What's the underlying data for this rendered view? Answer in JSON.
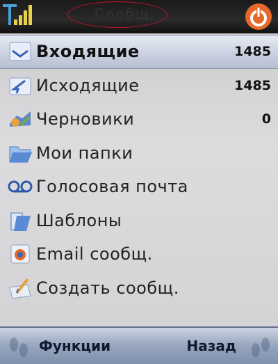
{
  "status_bar": {
    "title": "Сообщ.",
    "signal_icon": "signal-strength-icon",
    "power_icon": "power-icon"
  },
  "menu": {
    "items": [
      {
        "label": "Входящие",
        "count": "1485",
        "icon": "inbox-icon",
        "selected": true
      },
      {
        "label": "Исходящие",
        "count": "1485",
        "icon": "outbox-icon",
        "selected": false
      },
      {
        "label": "Черновики",
        "count": "0",
        "icon": "drafts-icon",
        "selected": false
      },
      {
        "label": "Мои папки",
        "count": "",
        "icon": "folder-icon",
        "selected": false
      },
      {
        "label": "Голосовая почта",
        "count": "",
        "icon": "voicemail-icon",
        "selected": false
      },
      {
        "label": "Шаблоны",
        "count": "",
        "icon": "templates-icon",
        "selected": false
      },
      {
        "label": "Email сообщ.",
        "count": "",
        "icon": "email-icon",
        "selected": false
      },
      {
        "label": "Создать сообщ.",
        "count": "",
        "icon": "compose-icon",
        "selected": false
      }
    ]
  },
  "softkeys": {
    "left_label": "Функции",
    "right_label": "Назад"
  },
  "colors": {
    "accent": "#e6682a",
    "selection": "#c8cfdf",
    "softkey_bar": "#9aa8c0",
    "annotation_oval": "#c3142a"
  }
}
